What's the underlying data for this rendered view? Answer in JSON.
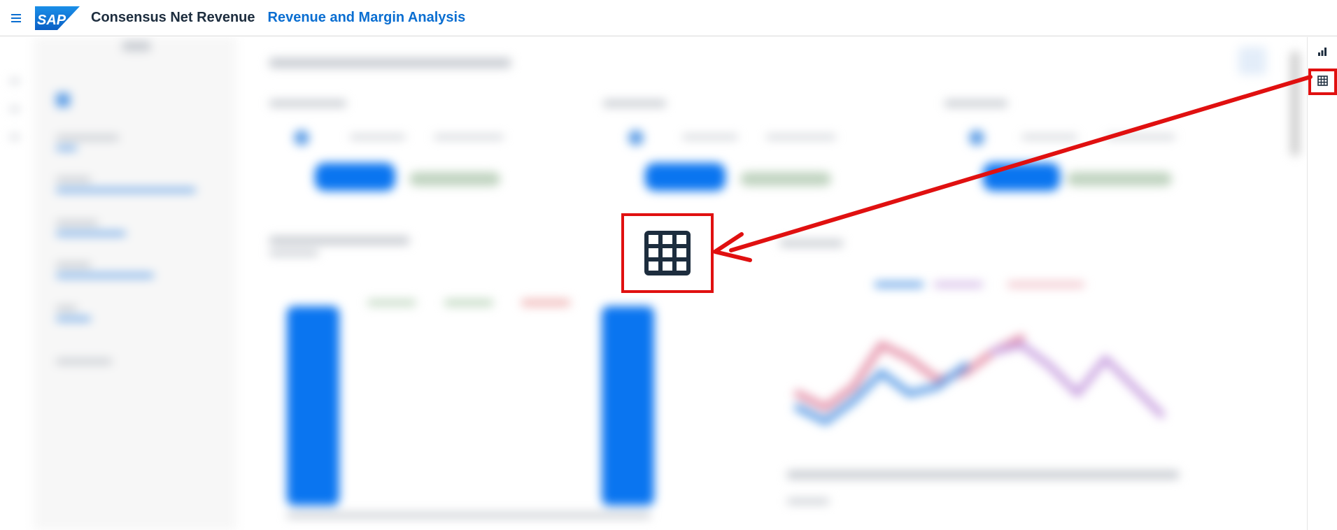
{
  "shell": {
    "app_title": "Consensus Net Revenue",
    "page_title": "Revenue and Margin Analysis",
    "logo_text": "SAP",
    "colors": {
      "logo_blue": "#0a6ed1",
      "title_blue": "#0a6ed1",
      "annotation_red": "#e01010"
    }
  },
  "toolbar": {
    "buttons": [
      {
        "name": "chart-view",
        "icon": "bar-chart-icon"
      },
      {
        "name": "table-view",
        "icon": "table-grid-icon",
        "highlighted": true
      }
    ]
  },
  "annotation": {
    "zoomed_icon": "table-grid-icon"
  }
}
